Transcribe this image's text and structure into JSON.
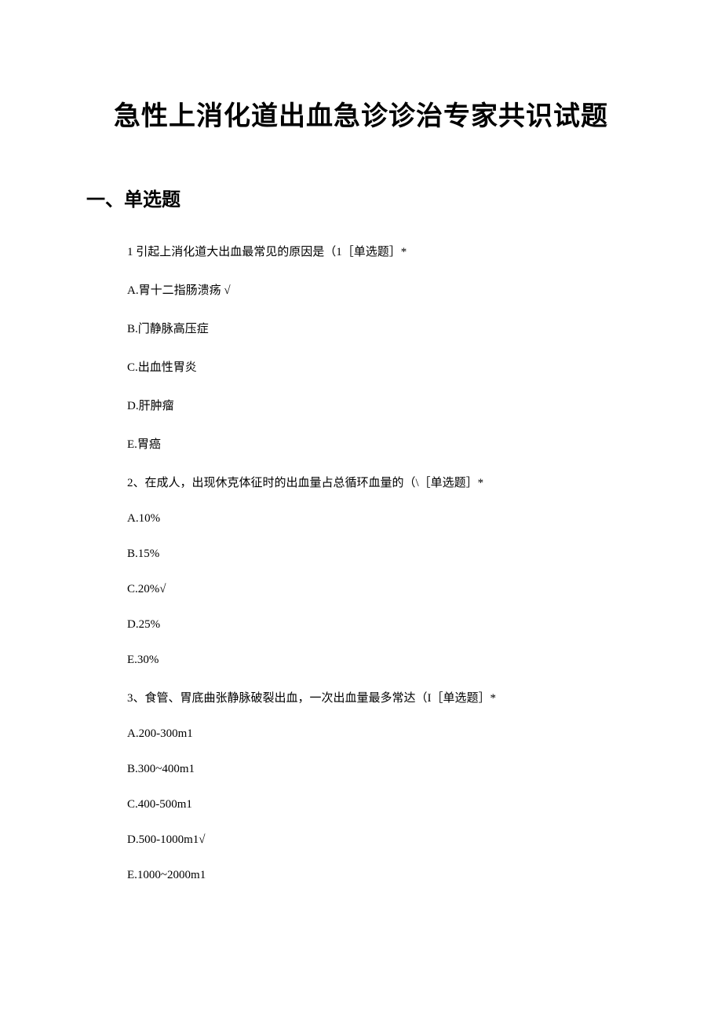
{
  "title": "急性上消化道出血急诊诊治专家共识试题",
  "section_heading": "一、单选题",
  "questions": [
    {
      "prompt": "1 引起上消化道大出血最常见的原因是（1［单选题］*",
      "options": [
        "A.胃十二指肠溃疡 √",
        "B.门静脉高压症",
        "C.出血性胃炎",
        "D.肝肿瘤",
        "E.胃癌"
      ]
    },
    {
      "prompt": "2、在成人，出现休克体征时的出血量占总循环血量的（\\［单选题］*",
      "options": [
        "A.10%",
        "B.15%",
        "C.20%√",
        "D.25%",
        "E.30%"
      ]
    },
    {
      "prompt": "3、食管、胃底曲张静脉破裂出血，一次出血量最多常达（I［单选题］*",
      "options": [
        "A.200-300m1",
        "B.300~400m1",
        "C.400-500m1",
        "D.500-1000m1√",
        "E.1000~2000m1"
      ]
    }
  ]
}
